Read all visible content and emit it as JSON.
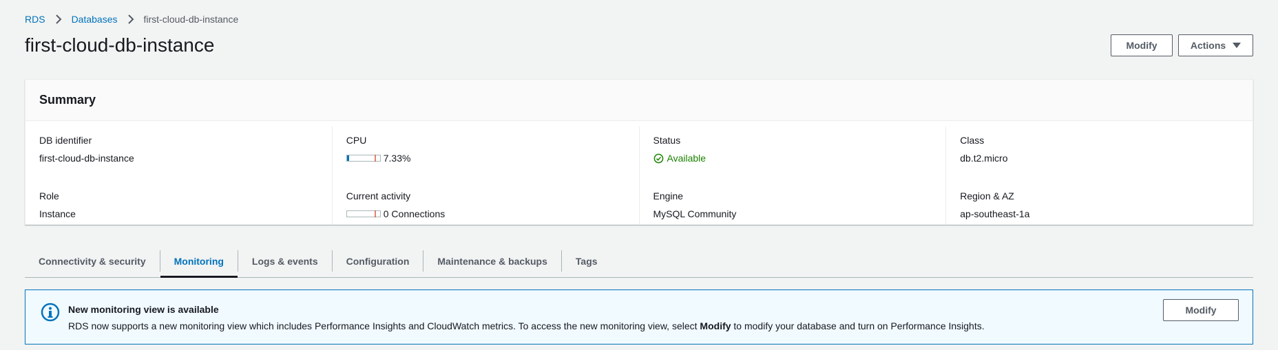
{
  "breadcrumb": {
    "items": [
      "RDS",
      "Databases"
    ],
    "current": "first-cloud-db-instance"
  },
  "page": {
    "title": "first-cloud-db-instance",
    "modify_label": "Modify",
    "actions_label": "Actions"
  },
  "summary": {
    "title": "Summary",
    "db_identifier": {
      "label": "DB identifier",
      "value": "first-cloud-db-instance"
    },
    "role": {
      "label": "Role",
      "value": "Instance"
    },
    "cpu": {
      "label": "CPU",
      "value": "7.33%",
      "fraction": 0.0733
    },
    "current_activity": {
      "label": "Current activity",
      "value": "0 Connections",
      "fraction": 0
    },
    "status": {
      "label": "Status",
      "value": "Available",
      "color": "#1d8102"
    },
    "engine": {
      "label": "Engine",
      "value": "MySQL Community"
    },
    "class": {
      "label": "Class",
      "value": "db.t2.micro"
    },
    "region": {
      "label": "Region & AZ",
      "value": "ap-southeast-1a"
    }
  },
  "tabs": [
    {
      "label": "Connectivity & security",
      "active": false
    },
    {
      "label": "Monitoring",
      "active": true
    },
    {
      "label": "Logs & events",
      "active": false
    },
    {
      "label": "Configuration",
      "active": false
    },
    {
      "label": "Maintenance & backups",
      "active": false
    },
    {
      "label": "Tags",
      "active": false
    }
  ],
  "flash": {
    "title": "New monitoring view is available",
    "text_before": "RDS now supports a new monitoring view which includes Performance Insights and CloudWatch metrics. To access the new monitoring view, select ",
    "text_bold": "Modify",
    "text_after": " to modify your database and turn on Performance Insights.",
    "button_label": "Modify",
    "icon": "info-icon"
  },
  "colors": {
    "accent": "#0073bb",
    "success": "#1d8102",
    "text": "#16191f",
    "secondary_text": "#545b64"
  }
}
